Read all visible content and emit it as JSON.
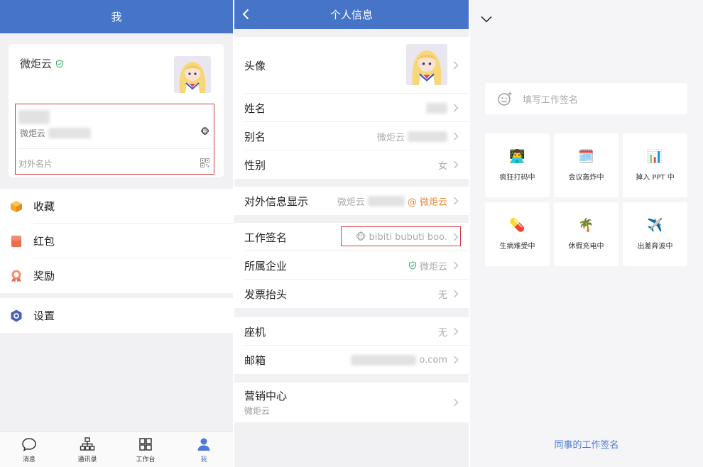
{
  "me_panel": {
    "title": "我",
    "card": {
      "name": "微炬云",
      "company_line": "微炬云",
      "external_card_label": "对外名片",
      "status_emoji": "🐵"
    },
    "menu": [
      {
        "label": "收藏",
        "icon": "box-icon",
        "color": "#f5a623"
      },
      {
        "label": "红包",
        "icon": "red-envelope-icon",
        "color": "#f06a4b"
      },
      {
        "label": "奖励",
        "icon": "award-ribbon-icon",
        "color": "#f06a4b"
      },
      {
        "label": "设置",
        "icon": "settings-hexagon-icon",
        "color": "#4a5fb5"
      }
    ],
    "tabs": [
      {
        "label": "消息",
        "icon": "chat-bubble-icon"
      },
      {
        "label": "通讯录",
        "icon": "org-chart-icon"
      },
      {
        "label": "工作台",
        "icon": "grid-icon"
      },
      {
        "label": "我",
        "icon": "person-icon",
        "active": true
      }
    ]
  },
  "profile_panel": {
    "title": "个人信息",
    "rows": {
      "avatar": "头像",
      "name": "姓名",
      "alias": "别名",
      "alias_value": "微炬云",
      "gender": "性别",
      "gender_value": "女",
      "external_display": "对外信息显示",
      "external_display_value": "微炬云",
      "external_display_suffix": "@ 微炬云",
      "work_signature": "工作签名",
      "work_signature_emoji": "🐵",
      "work_signature_value": "bibiti bubuti boo.",
      "company": "所属企业",
      "company_value": "微炬云",
      "invoice": "发票抬头",
      "invoice_value": "无",
      "landline": "座机",
      "landline_value": "无",
      "email": "邮箱",
      "email_value": "o.com",
      "marketing": "营销中心",
      "marketing_sub": "微炬云"
    }
  },
  "signature_panel": {
    "placeholder": "填写工作签名",
    "presets": [
      {
        "emoji": "👨‍💻",
        "label": "疯狂打码中"
      },
      {
        "emoji": "🗓️",
        "label": "会议轰炸中"
      },
      {
        "emoji": "📊",
        "label": "掉入 PPT 中"
      },
      {
        "emoji": "💊",
        "label": "生病难受中"
      },
      {
        "emoji": "🌴",
        "label": "休假充电中"
      },
      {
        "emoji": "✈️",
        "label": "出差奔波中"
      }
    ],
    "colleague_link": "同事的工作签名"
  },
  "colors": {
    "header_blue": "#4675c8",
    "accent_blue": "#4a79d6",
    "highlight_red": "#d23b3b",
    "verified_green": "#3cb371",
    "orange": "#e8893a"
  }
}
